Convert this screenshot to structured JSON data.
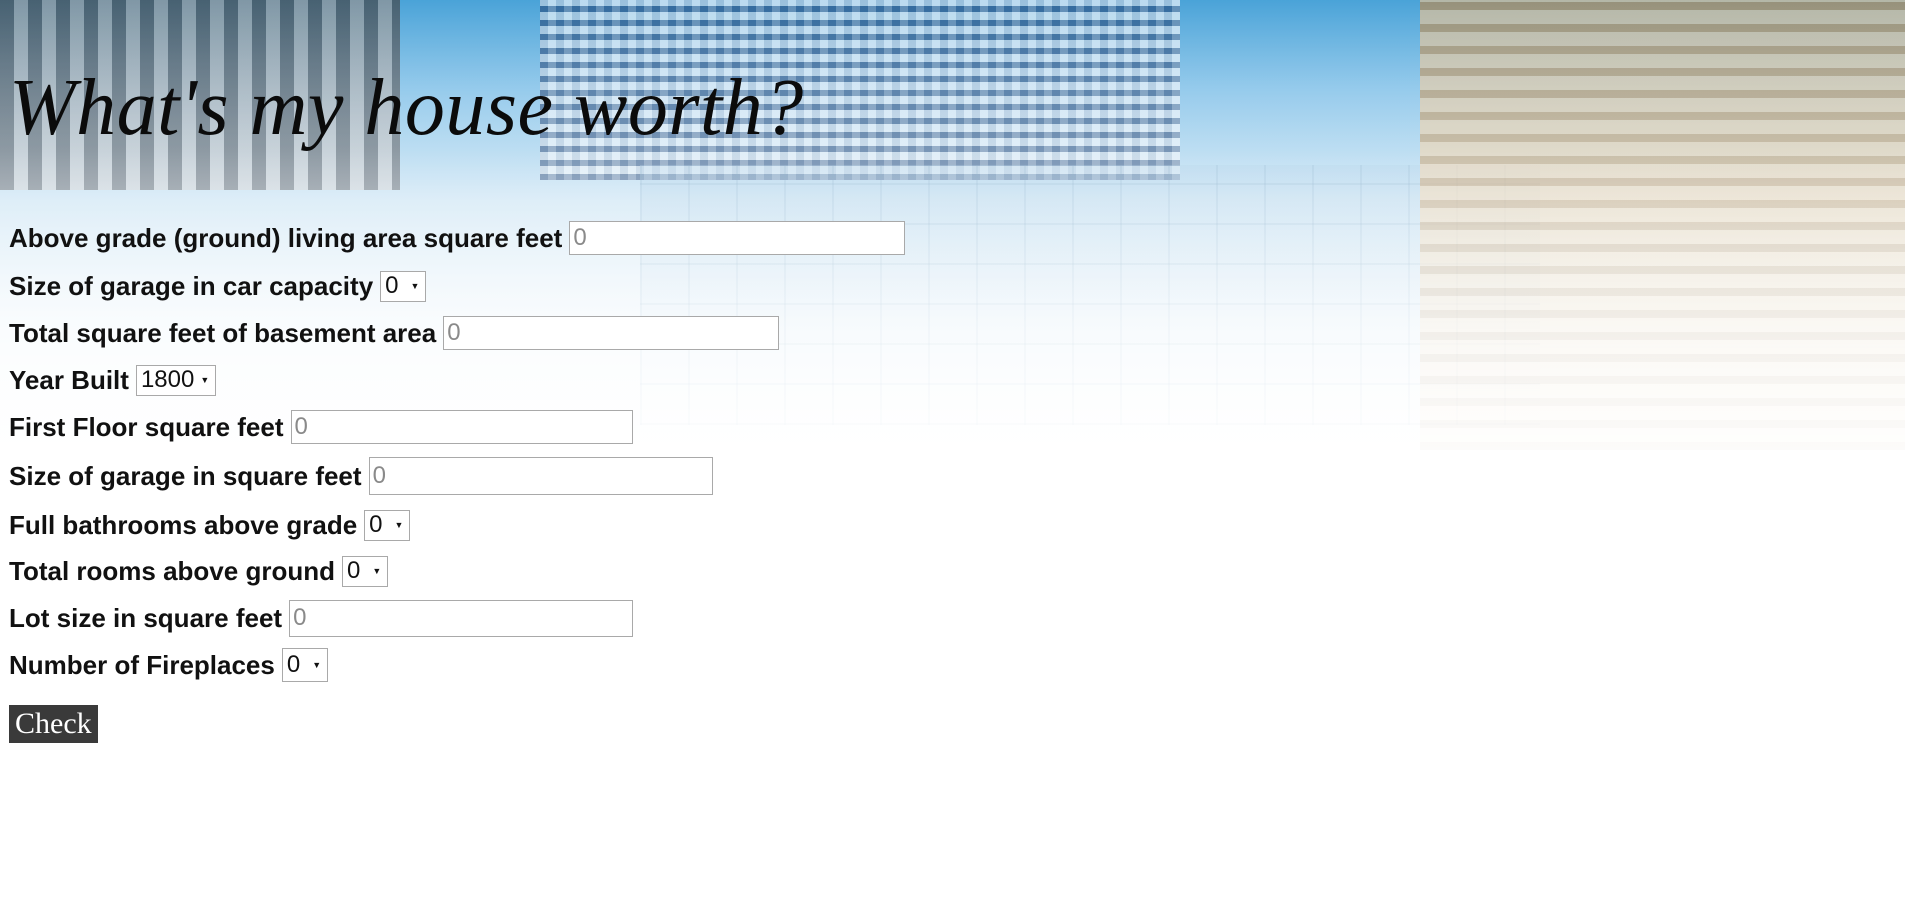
{
  "page": {
    "title": "What's my house worth?"
  },
  "form": {
    "fields": [
      {
        "label": "Above grade (ground) living area square feet",
        "type": "input",
        "placeholder": "0"
      },
      {
        "label": "Size of garage in car capacity",
        "type": "select",
        "value": "0"
      },
      {
        "label": "Total square feet of basement area",
        "type": "input",
        "placeholder": "0"
      },
      {
        "label": "Year Built",
        "type": "select",
        "value": "1800"
      },
      {
        "label": "First Floor square feet",
        "type": "input",
        "placeholder": "0"
      },
      {
        "label": "Size of garage in square feet",
        "type": "input",
        "placeholder": "0"
      },
      {
        "label": "Full bathrooms above grade",
        "type": "select",
        "value": "0"
      },
      {
        "label": "Total rooms above ground",
        "type": "select",
        "value": "0"
      },
      {
        "label": "Lot size in square feet",
        "type": "input",
        "placeholder": "0"
      },
      {
        "label": "Number of Fireplaces",
        "type": "select",
        "value": "0"
      }
    ],
    "submit_label": "Check"
  },
  "icons": {
    "select_arrow": "dropdown-arrow-icon"
  },
  "colors": {
    "button_bg": "#3a3a3a",
    "button_text": "#ffffff",
    "sky": "#4aa3d8"
  }
}
